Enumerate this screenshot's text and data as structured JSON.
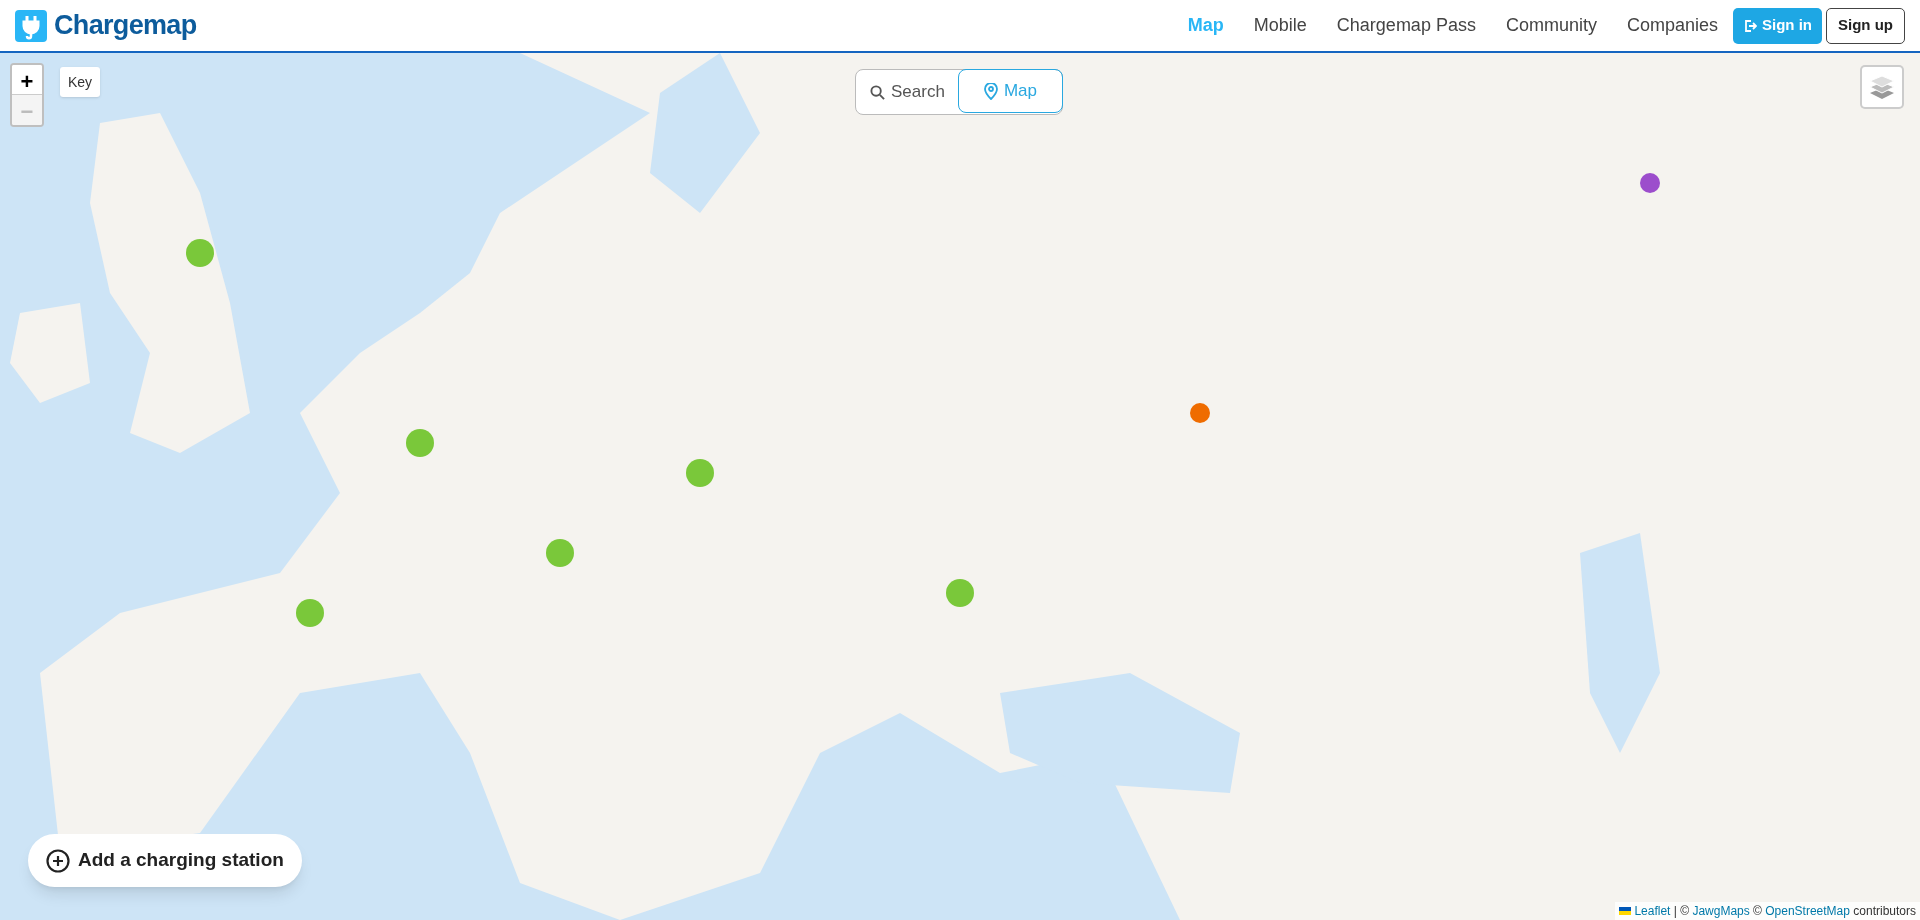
{
  "header": {
    "logo": "Chargemap",
    "nav": [
      {
        "label": "Map",
        "selected": true
      },
      {
        "label": "Mobile",
        "selected": false
      },
      {
        "label": "Chargemap Pass",
        "selected": false
      },
      {
        "label": "Community",
        "selected": false
      },
      {
        "label": "Companies",
        "selected": false
      }
    ],
    "sign_in": "Sign in",
    "sign_up": "Sign up"
  },
  "map": {
    "zoom_in": "+",
    "zoom_out": "−",
    "zoom_out_disabled": true,
    "key": "Key",
    "view_toggle": [
      {
        "label": "Search",
        "kind": "search",
        "selected": false
      },
      {
        "label": "Map",
        "kind": "map",
        "selected": true
      }
    ],
    "add_button": "Add a charging station",
    "attribution": [
      {
        "text": "Leaflet",
        "link": true
      },
      {
        "text": " | © ",
        "link": false
      },
      {
        "text": "JawgMaps",
        "link": true
      },
      {
        "text": " © ",
        "link": false
      },
      {
        "text": "OpenStreetMap",
        "link": true
      },
      {
        "text": " contributors",
        "link": false
      }
    ]
  }
}
